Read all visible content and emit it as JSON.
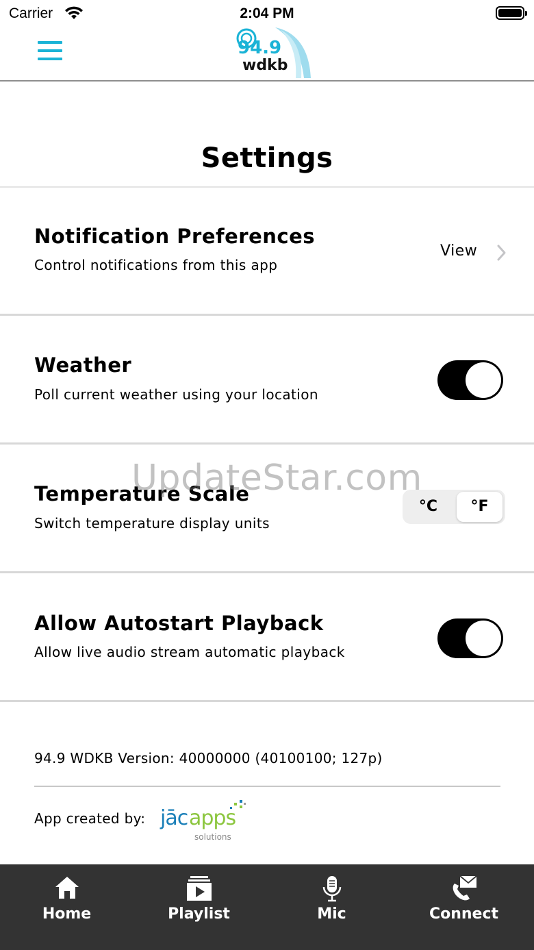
{
  "status_bar": {
    "carrier": "Carrier",
    "time": "2:04 PM"
  },
  "header": {
    "logo_text_top": "94.9",
    "logo_text_bottom": "wdkb",
    "menu_icon": "hamburger-icon"
  },
  "page": {
    "title": "Settings"
  },
  "settings": [
    {
      "title": "Notification Preferences",
      "subtitle": "Control notifications from this app",
      "action_label": "View"
    },
    {
      "title": "Weather",
      "subtitle": "Poll current weather using your location",
      "toggle_on": true
    },
    {
      "title": "Temperature Scale",
      "subtitle": "Switch temperature display units",
      "options": [
        "°C",
        "°F"
      ],
      "selected": "°F"
    },
    {
      "title": "Allow Autostart Playback",
      "subtitle": "Allow live audio stream automatic playback",
      "toggle_on": true
    }
  ],
  "watermark": "UpdateStar.com",
  "footer": {
    "version": "94.9 WDKB Version: 40000000 (40100100; 127p)",
    "created_by": "App created by:",
    "maker_logo_main": "jācapps",
    "maker_logo_sub": "solutions"
  },
  "tabs": [
    {
      "label": "Home",
      "icon": "home-icon"
    },
    {
      "label": "Playlist",
      "icon": "playlist-icon"
    },
    {
      "label": "Mic",
      "icon": "mic-icon"
    },
    {
      "label": "Connect",
      "icon": "connect-icon"
    }
  ],
  "colors": {
    "accent": "#1ab3d6",
    "tab_bar": "#333333",
    "toggle_on": "#000000"
  }
}
